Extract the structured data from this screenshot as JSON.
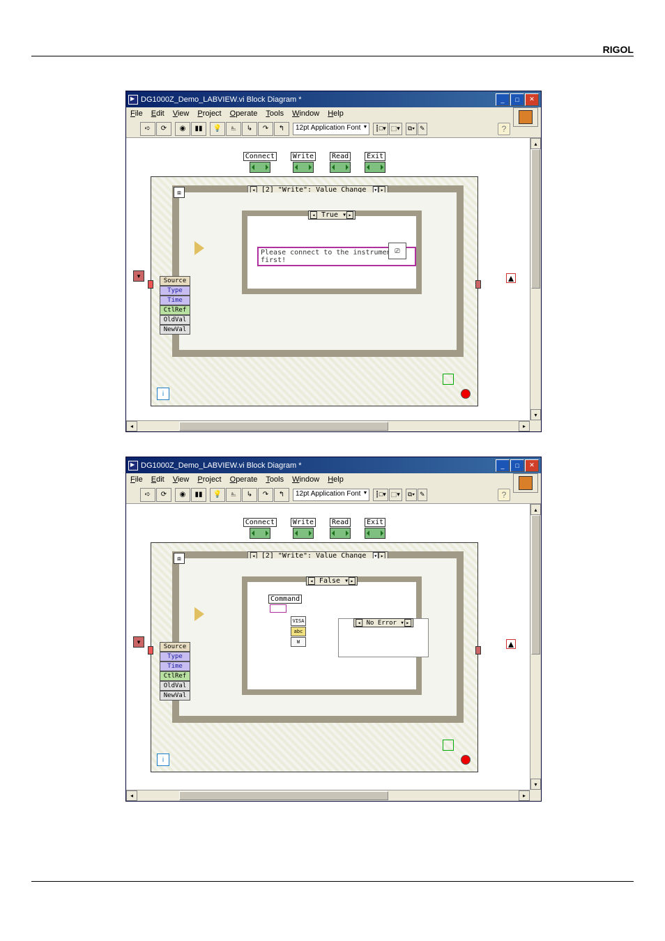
{
  "brand": "RIGOL",
  "window": {
    "title": "DG1000Z_Demo_LABVIEW.vi Block Diagram *",
    "min": "_",
    "max": "□",
    "close": "✕"
  },
  "menus": {
    "file": "File",
    "edit": "Edit",
    "view": "View",
    "project": "Project",
    "operate": "Operate",
    "tools": "Tools",
    "window": "Window",
    "help": "Help"
  },
  "toolbar": {
    "font_selector": "12pt Application Font",
    "help": "?"
  },
  "events": {
    "connect": "Connect",
    "write": "Write",
    "read": "Read",
    "exit": "Exit"
  },
  "frame": {
    "case_label_1": "[2] \"Write\": Value Change",
    "true_label": "True",
    "false_label": "False",
    "msg_warn": "Please connect to the instrument first!",
    "command_label": "Command",
    "no_error": "No Error",
    "visa_w": "VISA",
    "abc": "abc",
    "w": "W"
  },
  "cluster": {
    "r0": "Source",
    "r1": "Type",
    "r2": "Time",
    "r3": "CtlRef",
    "r4": "OldVal",
    "r5": "NewVal"
  },
  "loop": {
    "i": "i",
    "stop": "●"
  }
}
